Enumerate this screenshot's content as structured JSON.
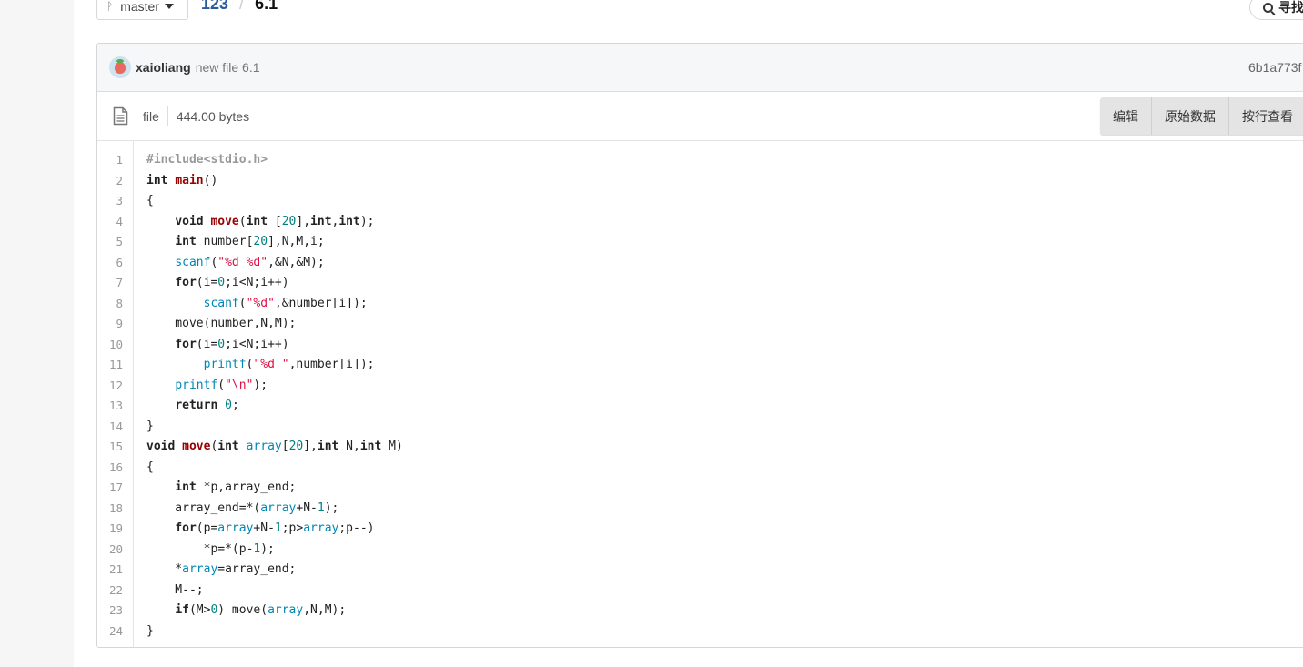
{
  "header": {
    "branch": "master",
    "breadcrumb_repo": "123",
    "breadcrumb_sep": "/",
    "breadcrumb_file": "6.1",
    "search_label": "寻找",
    "icons": {
      "branch": "branch-icon",
      "search": "search-icon",
      "caret": "caret-down-icon"
    }
  },
  "commit": {
    "author": "xaioliang",
    "message": "new file 6.1",
    "sha": "6b1a773f"
  },
  "file_header": {
    "type": "file",
    "size": "444.00 bytes",
    "buttons": [
      "编辑",
      "原始数据",
      "按行查看"
    ],
    "icons": {
      "doc": "document-icon"
    }
  },
  "code": {
    "line_numbers": [
      "1",
      "2",
      "3",
      "4",
      "5",
      "6",
      "7",
      "8",
      "9",
      "10",
      "11",
      "12",
      "13",
      "14",
      "15",
      "16",
      "17",
      "18",
      "19",
      "20",
      "21",
      "22",
      "23",
      "24"
    ],
    "lines": [
      "#include<stdio.h>",
      "int main()",
      "{",
      "    void move(int [20],int,int);",
      "    int number[20],N,M,i;",
      "    scanf(\"%d %d\",&N,&M);",
      "    for(i=0;i<N;i++)",
      "        scanf(\"%d\",&number[i]);",
      "    move(number,N,M);",
      "    for(i=0;i<N;i++)",
      "        printf(\"%d \",number[i]);",
      "    printf(\"\\n\");",
      "    return 0;",
      "}",
      "void move(int array[20],int N,int M)",
      "{",
      "    int *p,array_end;",
      "    array_end=*(array+N-1);",
      "    for(p=array+N-1;p>array;p--)",
      "        *p=*(p-1);",
      "    *array=array_end;",
      "    M--;",
      "    if(M>0) move(array,N,M);",
      "}"
    ]
  },
  "colors": {
    "keyword": "#222222",
    "function": "#990000",
    "number": "#008080",
    "string": "#dd1144",
    "builtin": "#0086b3",
    "link": "#2a5b9b"
  }
}
